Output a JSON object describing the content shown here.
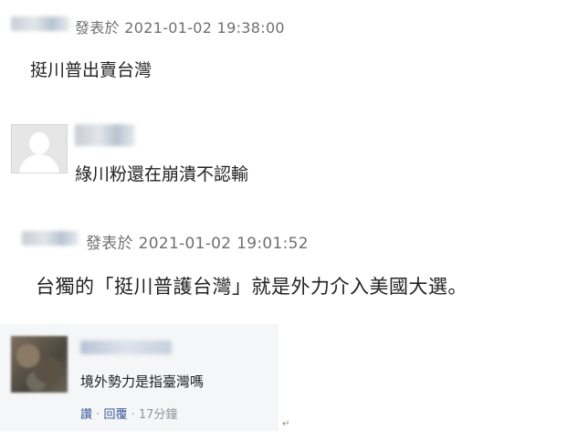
{
  "post1": {
    "meta": "發表於 2021-01-02 19:38:00",
    "text": "挺川普出賣台灣"
  },
  "comment1": {
    "text": "綠川粉還在崩潰不認輸"
  },
  "post2": {
    "meta": "發表於 2021-01-02 19:01:52",
    "text": "台獨的「挺川普護台灣」就是外力介入美國大選。"
  },
  "fb_comment": {
    "text": "境外勢力是指臺灣嗎",
    "like_label": "讚",
    "reply_label": "回覆",
    "separator": "·",
    "time": "17分鐘"
  },
  "colors": {
    "meta_gray": "#6f6f6f",
    "fb_link": "#385898",
    "fb_card_bg": "#f5f6f7"
  },
  "icons": {
    "default_avatar": "user-silhouette-icon",
    "paragraph_mark": "return-arrow-icon"
  }
}
